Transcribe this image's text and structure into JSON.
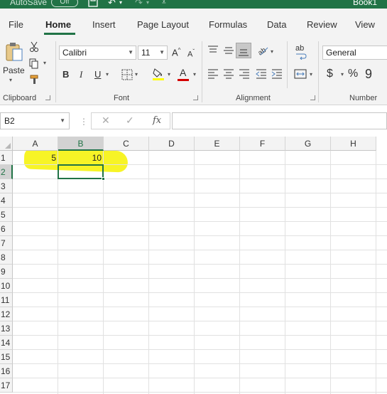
{
  "titlebar": {
    "autosave_label": "AutoSave",
    "autosave_state": "Off",
    "book_title": "Book1",
    "color": "#217346"
  },
  "tabs": [
    {
      "label": "File"
    },
    {
      "label": "Home",
      "active": true
    },
    {
      "label": "Insert"
    },
    {
      "label": "Page Layout"
    },
    {
      "label": "Formulas"
    },
    {
      "label": "Data"
    },
    {
      "label": "Review"
    },
    {
      "label": "View"
    }
  ],
  "ribbon": {
    "clipboard": {
      "label": "Clipboard",
      "paste_label": "Paste",
      "icons": [
        "paste-icon",
        "cut-icon",
        "copy-icon",
        "format-painter-icon"
      ]
    },
    "font": {
      "label": "Font",
      "font_name": "Calibri",
      "font_size": "11",
      "grow_label": "A",
      "shrink_label": "A",
      "bold_label": "B",
      "italic_label": "I",
      "underline_label": "U",
      "font_color_label": "A",
      "fill_color": "#ffff00",
      "font_color": "#d40000"
    },
    "alignment": {
      "label": "Alignment",
      "wrap_label": "ab"
    },
    "number": {
      "label": "Number",
      "format": "General",
      "currency_label": "$",
      "percent_label": "%",
      "comma_label": "9"
    }
  },
  "formula_bar": {
    "name_box": "B2",
    "cancel_label": "✕",
    "enter_label": "✓",
    "fx_label": "fx",
    "content": ""
  },
  "sheet": {
    "columns": [
      "A",
      "B",
      "C",
      "D",
      "E",
      "F",
      "G",
      "H"
    ],
    "rows": [
      "1",
      "2",
      "3",
      "4",
      "5",
      "6",
      "7",
      "8",
      "9",
      "10",
      "11",
      "12",
      "13",
      "14",
      "15",
      "16",
      "17"
    ],
    "selected_cell": "B2",
    "cells": {
      "A1": "5",
      "B1": "10"
    },
    "highlight_color": "#f6f200",
    "selection_color": "#217346"
  }
}
